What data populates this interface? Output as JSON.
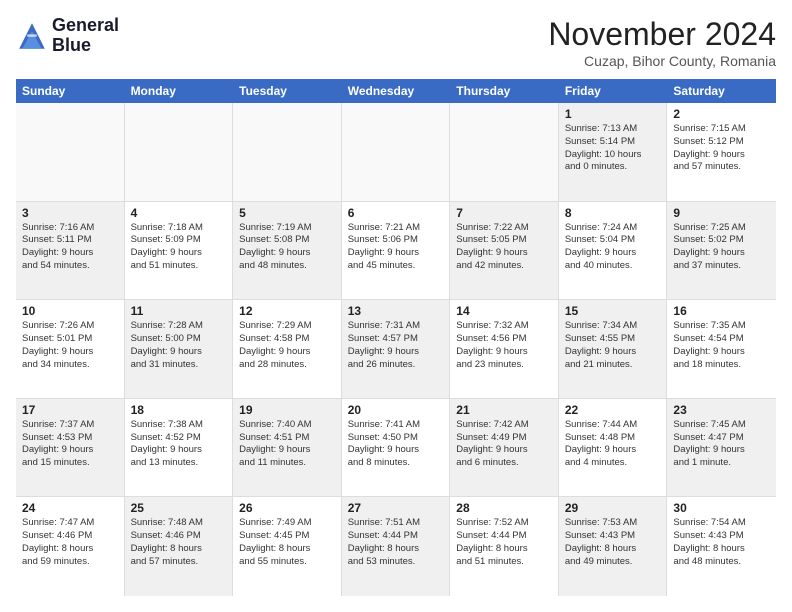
{
  "logo": {
    "line1": "General",
    "line2": "Blue"
  },
  "title": "November 2024",
  "location": "Cuzap, Bihor County, Romania",
  "weekdays": [
    "Sunday",
    "Monday",
    "Tuesday",
    "Wednesday",
    "Thursday",
    "Friday",
    "Saturday"
  ],
  "weeks": [
    [
      {
        "day": "",
        "lines": [],
        "empty": true
      },
      {
        "day": "",
        "lines": [],
        "empty": true
      },
      {
        "day": "",
        "lines": [],
        "empty": true
      },
      {
        "day": "",
        "lines": [],
        "empty": true
      },
      {
        "day": "",
        "lines": [],
        "empty": true
      },
      {
        "day": "1",
        "lines": [
          "Sunrise: 7:13 AM",
          "Sunset: 5:14 PM",
          "Daylight: 10 hours",
          "and 0 minutes."
        ],
        "shaded": true
      },
      {
        "day": "2",
        "lines": [
          "Sunrise: 7:15 AM",
          "Sunset: 5:12 PM",
          "Daylight: 9 hours",
          "and 57 minutes."
        ],
        "shaded": false
      }
    ],
    [
      {
        "day": "3",
        "lines": [
          "Sunrise: 7:16 AM",
          "Sunset: 5:11 PM",
          "Daylight: 9 hours",
          "and 54 minutes."
        ],
        "shaded": true
      },
      {
        "day": "4",
        "lines": [
          "Sunrise: 7:18 AM",
          "Sunset: 5:09 PM",
          "Daylight: 9 hours",
          "and 51 minutes."
        ],
        "shaded": false
      },
      {
        "day": "5",
        "lines": [
          "Sunrise: 7:19 AM",
          "Sunset: 5:08 PM",
          "Daylight: 9 hours",
          "and 48 minutes."
        ],
        "shaded": true
      },
      {
        "day": "6",
        "lines": [
          "Sunrise: 7:21 AM",
          "Sunset: 5:06 PM",
          "Daylight: 9 hours",
          "and 45 minutes."
        ],
        "shaded": false
      },
      {
        "day": "7",
        "lines": [
          "Sunrise: 7:22 AM",
          "Sunset: 5:05 PM",
          "Daylight: 9 hours",
          "and 42 minutes."
        ],
        "shaded": true
      },
      {
        "day": "8",
        "lines": [
          "Sunrise: 7:24 AM",
          "Sunset: 5:04 PM",
          "Daylight: 9 hours",
          "and 40 minutes."
        ],
        "shaded": false
      },
      {
        "day": "9",
        "lines": [
          "Sunrise: 7:25 AM",
          "Sunset: 5:02 PM",
          "Daylight: 9 hours",
          "and 37 minutes."
        ],
        "shaded": true
      }
    ],
    [
      {
        "day": "10",
        "lines": [
          "Sunrise: 7:26 AM",
          "Sunset: 5:01 PM",
          "Daylight: 9 hours",
          "and 34 minutes."
        ],
        "shaded": false
      },
      {
        "day": "11",
        "lines": [
          "Sunrise: 7:28 AM",
          "Sunset: 5:00 PM",
          "Daylight: 9 hours",
          "and 31 minutes."
        ],
        "shaded": true
      },
      {
        "day": "12",
        "lines": [
          "Sunrise: 7:29 AM",
          "Sunset: 4:58 PM",
          "Daylight: 9 hours",
          "and 28 minutes."
        ],
        "shaded": false
      },
      {
        "day": "13",
        "lines": [
          "Sunrise: 7:31 AM",
          "Sunset: 4:57 PM",
          "Daylight: 9 hours",
          "and 26 minutes."
        ],
        "shaded": true
      },
      {
        "day": "14",
        "lines": [
          "Sunrise: 7:32 AM",
          "Sunset: 4:56 PM",
          "Daylight: 9 hours",
          "and 23 minutes."
        ],
        "shaded": false
      },
      {
        "day": "15",
        "lines": [
          "Sunrise: 7:34 AM",
          "Sunset: 4:55 PM",
          "Daylight: 9 hours",
          "and 21 minutes."
        ],
        "shaded": true
      },
      {
        "day": "16",
        "lines": [
          "Sunrise: 7:35 AM",
          "Sunset: 4:54 PM",
          "Daylight: 9 hours",
          "and 18 minutes."
        ],
        "shaded": false
      }
    ],
    [
      {
        "day": "17",
        "lines": [
          "Sunrise: 7:37 AM",
          "Sunset: 4:53 PM",
          "Daylight: 9 hours",
          "and 15 minutes."
        ],
        "shaded": true
      },
      {
        "day": "18",
        "lines": [
          "Sunrise: 7:38 AM",
          "Sunset: 4:52 PM",
          "Daylight: 9 hours",
          "and 13 minutes."
        ],
        "shaded": false
      },
      {
        "day": "19",
        "lines": [
          "Sunrise: 7:40 AM",
          "Sunset: 4:51 PM",
          "Daylight: 9 hours",
          "and 11 minutes."
        ],
        "shaded": true
      },
      {
        "day": "20",
        "lines": [
          "Sunrise: 7:41 AM",
          "Sunset: 4:50 PM",
          "Daylight: 9 hours",
          "and 8 minutes."
        ],
        "shaded": false
      },
      {
        "day": "21",
        "lines": [
          "Sunrise: 7:42 AM",
          "Sunset: 4:49 PM",
          "Daylight: 9 hours",
          "and 6 minutes."
        ],
        "shaded": true
      },
      {
        "day": "22",
        "lines": [
          "Sunrise: 7:44 AM",
          "Sunset: 4:48 PM",
          "Daylight: 9 hours",
          "and 4 minutes."
        ],
        "shaded": false
      },
      {
        "day": "23",
        "lines": [
          "Sunrise: 7:45 AM",
          "Sunset: 4:47 PM",
          "Daylight: 9 hours",
          "and 1 minute."
        ],
        "shaded": true
      }
    ],
    [
      {
        "day": "24",
        "lines": [
          "Sunrise: 7:47 AM",
          "Sunset: 4:46 PM",
          "Daylight: 8 hours",
          "and 59 minutes."
        ],
        "shaded": false
      },
      {
        "day": "25",
        "lines": [
          "Sunrise: 7:48 AM",
          "Sunset: 4:46 PM",
          "Daylight: 8 hours",
          "and 57 minutes."
        ],
        "shaded": true
      },
      {
        "day": "26",
        "lines": [
          "Sunrise: 7:49 AM",
          "Sunset: 4:45 PM",
          "Daylight: 8 hours",
          "and 55 minutes."
        ],
        "shaded": false
      },
      {
        "day": "27",
        "lines": [
          "Sunrise: 7:51 AM",
          "Sunset: 4:44 PM",
          "Daylight: 8 hours",
          "and 53 minutes."
        ],
        "shaded": true
      },
      {
        "day": "28",
        "lines": [
          "Sunrise: 7:52 AM",
          "Sunset: 4:44 PM",
          "Daylight: 8 hours",
          "and 51 minutes."
        ],
        "shaded": false
      },
      {
        "day": "29",
        "lines": [
          "Sunrise: 7:53 AM",
          "Sunset: 4:43 PM",
          "Daylight: 8 hours",
          "and 49 minutes."
        ],
        "shaded": true
      },
      {
        "day": "30",
        "lines": [
          "Sunrise: 7:54 AM",
          "Sunset: 4:43 PM",
          "Daylight: 8 hours",
          "and 48 minutes."
        ],
        "shaded": false
      }
    ]
  ]
}
